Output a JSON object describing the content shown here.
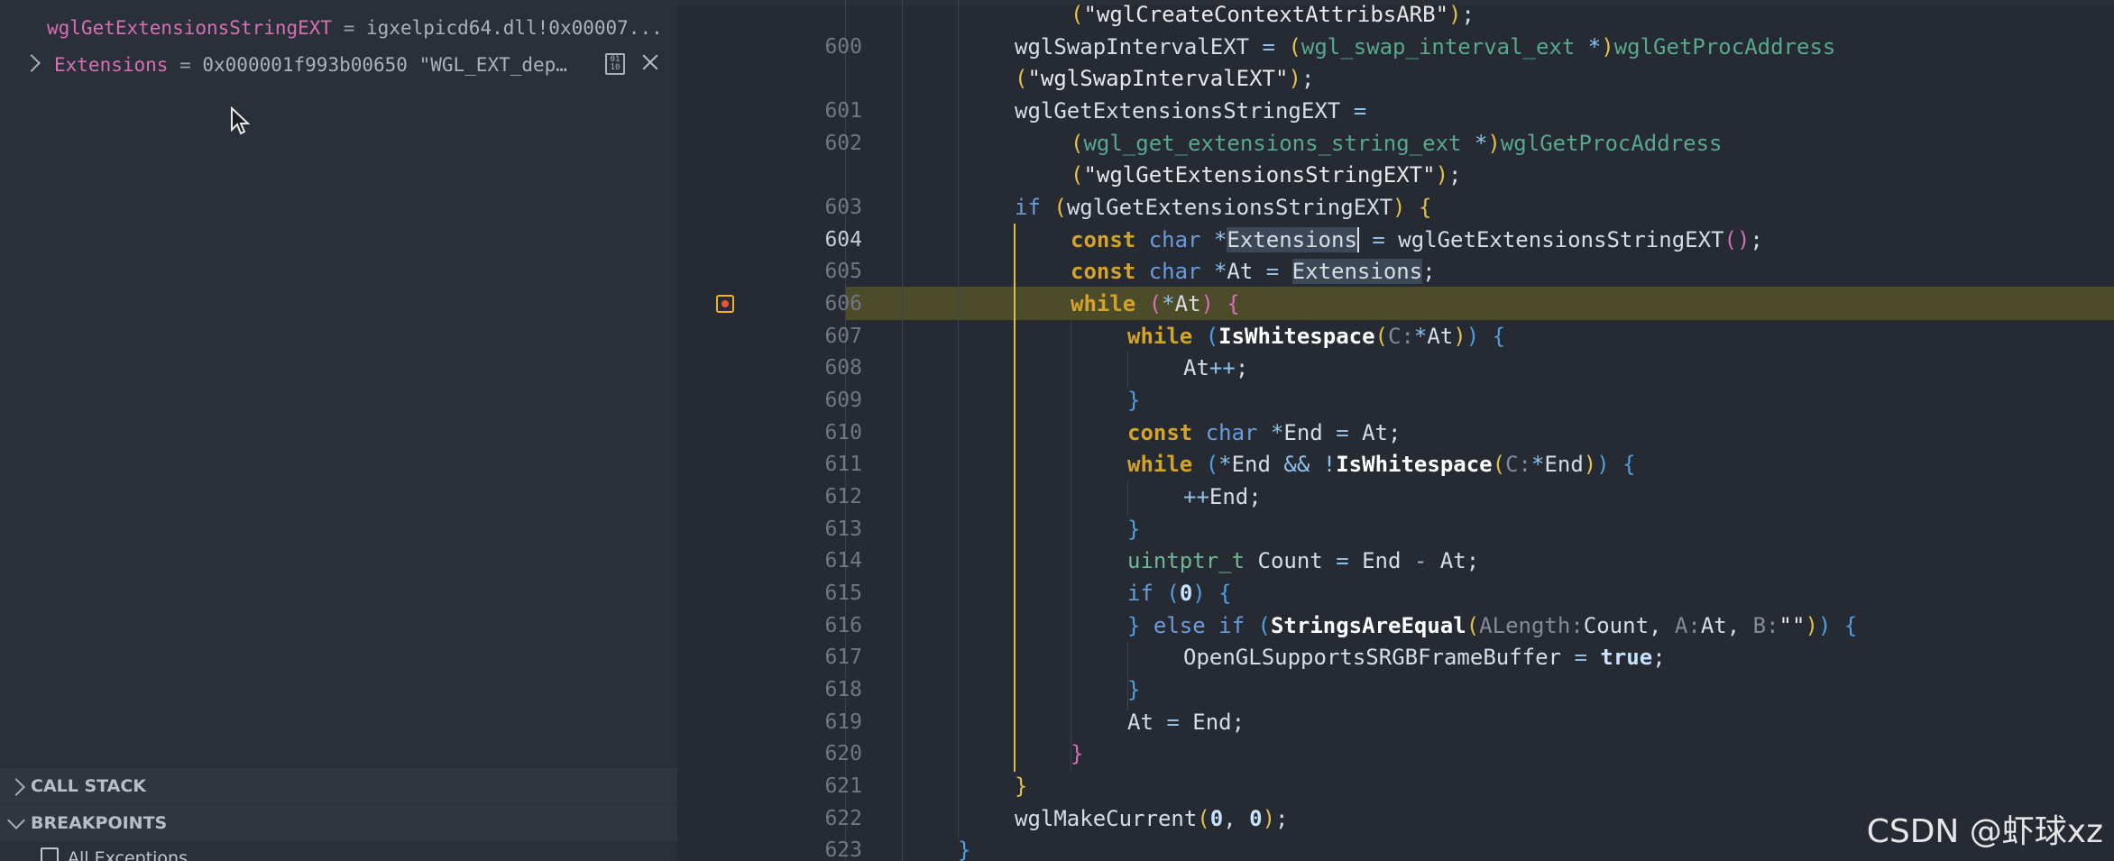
{
  "debug_panel": {
    "watch_items": [
      {
        "name": "wglGetExtensionsStringEXT",
        "sep": " = ",
        "value": "igxelpicd64.dll!0x00007..."
      },
      {
        "name": "Extensions",
        "sep": " = ",
        "value": "0x000001f993b00650 \"WGL_EXT_dep…"
      }
    ],
    "sections": {
      "call_stack": "CALL STACK",
      "breakpoints": "BREAKPOINTS"
    },
    "breakpoint_items": [
      "All Exceptions"
    ]
  },
  "editor": {
    "lines": [
      {
        "num": "",
        "y": 0
      },
      {
        "num": "600"
      },
      {
        "num": ""
      },
      {
        "num": "601"
      },
      {
        "num": "602"
      },
      {
        "num": ""
      },
      {
        "num": "603"
      },
      {
        "num": "604"
      },
      {
        "num": "605"
      },
      {
        "num": "606"
      },
      {
        "num": "607"
      },
      {
        "num": "608"
      },
      {
        "num": "609"
      },
      {
        "num": "610"
      },
      {
        "num": "611"
      },
      {
        "num": "612"
      },
      {
        "num": "613"
      },
      {
        "num": "614"
      },
      {
        "num": "615"
      },
      {
        "num": "616"
      },
      {
        "num": "617"
      },
      {
        "num": "618"
      },
      {
        "num": "619"
      },
      {
        "num": "620"
      },
      {
        "num": "621"
      },
      {
        "num": "622"
      },
      {
        "num": "623"
      }
    ],
    "current_line": "604",
    "breakpoint_line": "606"
  },
  "watermark": "CSDN @虾球xz",
  "colors": {
    "panel_bg": "#2a3039",
    "editor_bg": "#252a33",
    "highlight_line": "#4d4c2a",
    "breakpoint": "#f0b31b"
  }
}
